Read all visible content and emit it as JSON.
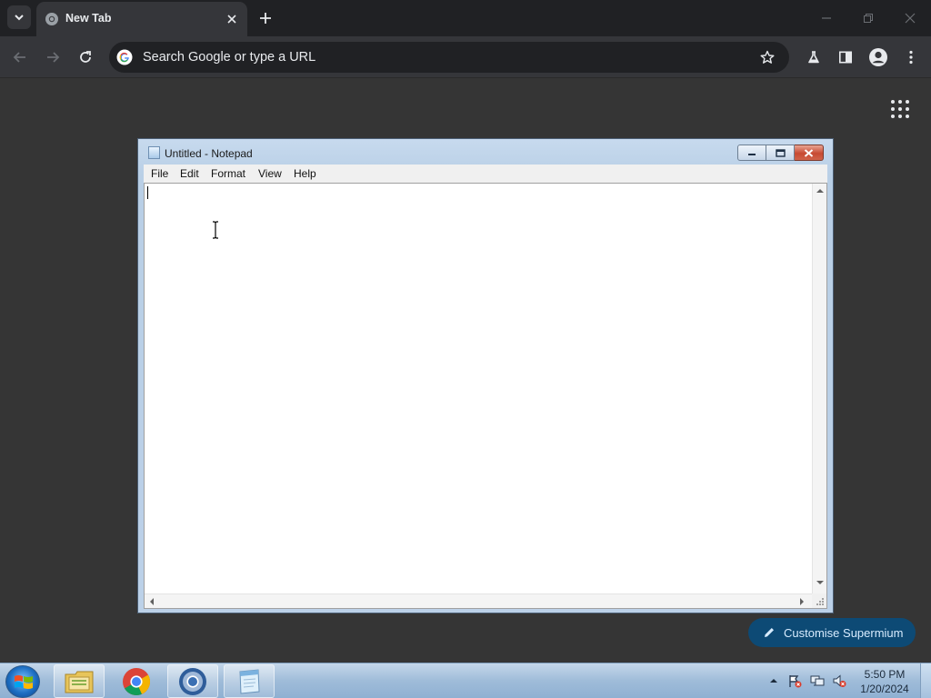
{
  "browser": {
    "tab": {
      "title": "New Tab"
    },
    "omnibox": {
      "placeholder": "Search Google or type a URL"
    },
    "customise_label": "Customise Supermium"
  },
  "notepad": {
    "title": "Untitled - Notepad",
    "menu": [
      "File",
      "Edit",
      "Format",
      "View",
      "Help"
    ],
    "content": ""
  },
  "taskbar": {
    "apps": [
      "file-explorer-icon",
      "chrome-icon",
      "supermium-icon",
      "notepad-icon"
    ],
    "clock": {
      "time": "5:50 PM",
      "date": "1/20/2024"
    }
  },
  "colors": {
    "tabstrip": "#202124",
    "toolbar": "#35363a",
    "page_background": "#353535",
    "customise_button": "#0d4a75",
    "notepad_frame": "#bcd1e8",
    "close_button": "#c74a32"
  }
}
